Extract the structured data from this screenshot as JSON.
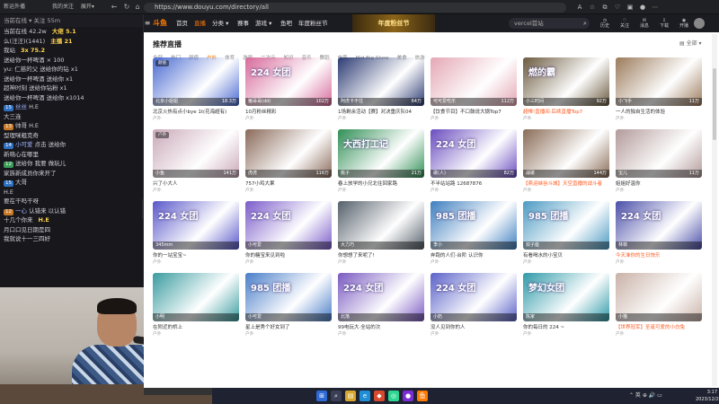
{
  "browser": {
    "url": "https://www.douyu.com/directory/all",
    "left_tabs": [
      "新运外播",
      "我的关注",
      "展开▾"
    ]
  },
  "chat": {
    "top_text": "当前在线 ▾ 关注 55m",
    "rows": [
      {
        "badge": "",
        "badge_color": "",
        "user": "",
        "text": "当前在线 42.2w",
        "extra": "大佬 5.1"
      },
      {
        "badge": "",
        "badge_color": "",
        "user": "",
        "text": "么(汪汪)(1441)",
        "extra": "主播 21"
      },
      {
        "badge": "",
        "badge_color": "",
        "user": "",
        "text": "我站",
        "extra": "3x 75.2"
      },
      {
        "badge": "",
        "badge_color": "",
        "user": "",
        "text": "送给你一杯啤酒 × 100",
        "extra": ""
      },
      {
        "badge": "",
        "badge_color": "",
        "user": "",
        "text": "yu: 仁慈的父 送给你的钻 x1",
        "extra": ""
      },
      {
        "badge": "",
        "badge_color": "",
        "user": "",
        "text": "送给你一杯啤酒 送给你 x1",
        "extra": ""
      },
      {
        "badge": "",
        "badge_color": "",
        "user": "",
        "text": "超神时刻 送给你钻粉 x1",
        "extra": ""
      },
      {
        "badge": "",
        "badge_color": "",
        "user": "",
        "text": "送给你一杯啤酒 送给你 x1014",
        "extra": ""
      },
      {
        "badge": "15",
        "badge_color": "b",
        "user": "丝丝",
        "text": "H.E",
        "extra": ""
      },
      {
        "badge": "",
        "badge_color": "",
        "user": "",
        "text": "大三连",
        "extra": ""
      },
      {
        "badge": "13",
        "badge_color": "o",
        "user": "",
        "text": "帅哥 H.E",
        "extra": ""
      },
      {
        "badge": "",
        "badge_color": "",
        "user": "",
        "text": "型理咪粗克奇",
        "extra": ""
      },
      {
        "badge": "14",
        "badge_color": "b",
        "user": "小可爱",
        "text": "点击 送给你",
        "extra": ""
      },
      {
        "badge": "",
        "badge_color": "",
        "user": "",
        "text": "新晓心在哪里",
        "extra": ""
      },
      {
        "badge": "12",
        "badge_color": "g",
        "user": "",
        "text": "送给你 我要 做玩儿",
        "extra": ""
      },
      {
        "badge": "",
        "badge_color": "",
        "user": "",
        "text": "家族新成员你来开了",
        "extra": ""
      },
      {
        "badge": "15",
        "badge_color": "b",
        "user": "",
        "text": "大哥",
        "extra": ""
      },
      {
        "badge": "",
        "badge_color": "",
        "user": "",
        "text": "H.E",
        "extra": ""
      },
      {
        "badge": "",
        "badge_color": "",
        "user": "",
        "text": "要在干吗干呀",
        "extra": ""
      },
      {
        "badge": "12",
        "badge_color": "o",
        "user": "一心",
        "text": "认错来 以认错",
        "extra": ""
      },
      {
        "badge": "",
        "badge_color": "",
        "user": "",
        "text": "十几个你来",
        "extra": "H.E"
      },
      {
        "badge": "",
        "badge_color": "",
        "user": "",
        "text": "月口口见日期是四",
        "extra": ""
      },
      {
        "badge": "",
        "badge_color": "",
        "user": "",
        "text": "我就说十一三四好",
        "extra": ""
      }
    ]
  },
  "header": {
    "logo": "斗鱼",
    "nav": [
      "首页",
      "直播",
      "分类 ▾",
      "赛事",
      "游戏 ▾",
      "鱼吧",
      "年度粉丝节"
    ],
    "banner": "年度粉丝节",
    "search_placeholder": "vercel首站",
    "icons": [
      "历史",
      "关注",
      "消息",
      "下载",
      "开播"
    ]
  },
  "section": {
    "title": "推荐直播",
    "right_link": "▤ 全部 ▾",
    "filters": [
      "全部",
      "热门",
      "颜值",
      "户外",
      "体育",
      "游戏",
      "二次元",
      "知识",
      "音乐",
      "舞蹈",
      "电竞",
      "Mid·Big Show",
      "美食",
      "旅游"
    ]
  },
  "cards": [
    {
      "title": "北京火热有点小bye 1t(花海超有)",
      "sub": "户外",
      "viewer": "18.3万",
      "caption": "北京小姐姐",
      "tag": "颜值",
      "bg": "#4a6ad1",
      "hot": false,
      "promo": ""
    },
    {
      "title": "10月粉丝精彩",
      "sub": "户外",
      "viewer": "102万",
      "caption": "猪哥哥(dd)",
      "tag": "",
      "bg": "#d76a9b",
      "hot": false,
      "promo": "224 女团"
    },
    {
      "title": "1场剩余活动【赛】对决重庆队04",
      "sub": "户外",
      "viewer": "64万",
      "caption": "阿虎卡不住",
      "tag": "",
      "bg": "#2c3b73",
      "hot": false,
      "promo": ""
    },
    {
      "title": "【饮食节目】不口鼓说大锅Top7",
      "sub": "户外",
      "viewer": "112万",
      "caption": "可可爱吃乐",
      "tag": "",
      "bg": "#e4a7b4",
      "hot": false,
      "promo": ""
    },
    {
      "title": "超棒!直播间·后续直播Top7",
      "sub": "户外",
      "viewer": "92万",
      "caption": "小三时间",
      "tag": "",
      "bg": "#6b5a3e",
      "hot": true,
      "promo": "燃的霸"
    },
    {
      "title": "一人的独自生活的体验",
      "sub": "户外",
      "viewer": "11万",
      "caption": "小飞手",
      "tag": "",
      "bg": "#9b7b5c",
      "hot": false,
      "promo": ""
    },
    {
      "title": "兴了小大人",
      "sub": "户外",
      "viewer": "141万",
      "caption": "小鱼",
      "tag": "户外",
      "bg": "#c9a8b8",
      "hot": false,
      "promo": ""
    },
    {
      "title": "757小鸡大果",
      "sub": "户外",
      "viewer": "116万",
      "caption": "虎虎",
      "tag": "",
      "bg": "#8a6a5a",
      "hot": false,
      "promo": ""
    },
    {
      "title": "春上放学的小兄北往回家路",
      "sub": "户外",
      "viewer": "21万",
      "caption": "桃子",
      "tag": "",
      "bg": "#2f8f55",
      "hot": false,
      "promo": "大西打工记"
    },
    {
      "title": "不半站站路 12687876",
      "sub": "户外",
      "viewer": "82万",
      "caption": "歌(人)",
      "tag": "",
      "bg": "#6a4cbf",
      "hot": false,
      "promo": "224 女团"
    },
    {
      "title": "【燕运峡谷斗城】天空直播的战斗者",
      "sub": "户外",
      "viewer": "144万",
      "caption": "战歌",
      "tag": "",
      "bg": "#8a6c56",
      "hot": true,
      "promo": ""
    },
    {
      "title": "姐姐好温你",
      "sub": "户外",
      "viewer": "11万",
      "caption": "宝儿",
      "tag": "",
      "bg": "#b39a9a",
      "hot": false,
      "promo": ""
    },
    {
      "title": "你的一站宝宝~",
      "sub": "户外",
      "viewer": "",
      "caption": "345mm",
      "tag": "",
      "bg": "#5a58c9",
      "hot": false,
      "promo": "224 女团"
    },
    {
      "title": "你的糖宝来见到啦",
      "sub": "户外",
      "viewer": "",
      "caption": "小可爱",
      "tag": "",
      "bg": "#7b5cc9",
      "hot": false,
      "promo": "224 女团"
    },
    {
      "title": "你想想了来呢了!",
      "sub": "户外",
      "viewer": "",
      "caption": "大力巧",
      "tag": "",
      "bg": "#55606b",
      "hot": false,
      "promo": ""
    },
    {
      "title": "奔跑的人们·台阶 认识你",
      "sub": "户外",
      "viewer": "",
      "caption": "李小",
      "tag": "",
      "bg": "#3f7fbf",
      "hot": false,
      "promo": "985 团播"
    },
    {
      "title": "有看喝水的小宝贝",
      "sub": "户外",
      "viewer": "",
      "caption": "双子座",
      "tag": "",
      "bg": "#4c9ac2",
      "hot": false,
      "promo": "985 团播"
    },
    {
      "title": "今天准你的生日快乐",
      "sub": "户外",
      "viewer": "",
      "caption": "林菲",
      "tag": "",
      "bg": "#4b4fa8",
      "hot": true,
      "promo": "224 女团"
    },
    {
      "title": "在附近的桥上",
      "sub": "户外",
      "viewer": "",
      "caption": "小明",
      "tag": "",
      "bg": "#3a9ca0",
      "hot": false,
      "promo": ""
    },
    {
      "title": "星上是秀个好女到了",
      "sub": "户外",
      "viewer": "",
      "caption": "小可爱",
      "tag": "",
      "bg": "#4a7ec8",
      "hot": false,
      "promo": "985 团播"
    },
    {
      "title": "99电玩大·全站的次",
      "sub": "户外",
      "viewer": "",
      "caption": "北落",
      "tag": "",
      "bg": "#7a5ac1",
      "hot": false,
      "promo": "224 女团"
    },
    {
      "title": "没人见到你的人",
      "sub": "户外",
      "viewer": "",
      "caption": "小奶",
      "tag": "",
      "bg": "#5b62c8",
      "hot": false,
      "promo": "224 女团"
    },
    {
      "title": "你的每日的 224 ~",
      "sub": "户外",
      "viewer": "",
      "caption": "陈家",
      "tag": "",
      "bg": "#2f9aa8",
      "hot": false,
      "promo": "梦幻女团"
    },
    {
      "title": "【世界冠军】圣诞可爱的小白兔",
      "sub": "户外",
      "viewer": "",
      "caption": "小猫",
      "tag": "",
      "bg": "#c9b2a8",
      "hot": true,
      "promo": ""
    }
  ],
  "taskbar": {
    "tray": "⌃ 英 ⊕ 🔊 ▭",
    "time": "3:17",
    "date": "2023/12/29"
  }
}
